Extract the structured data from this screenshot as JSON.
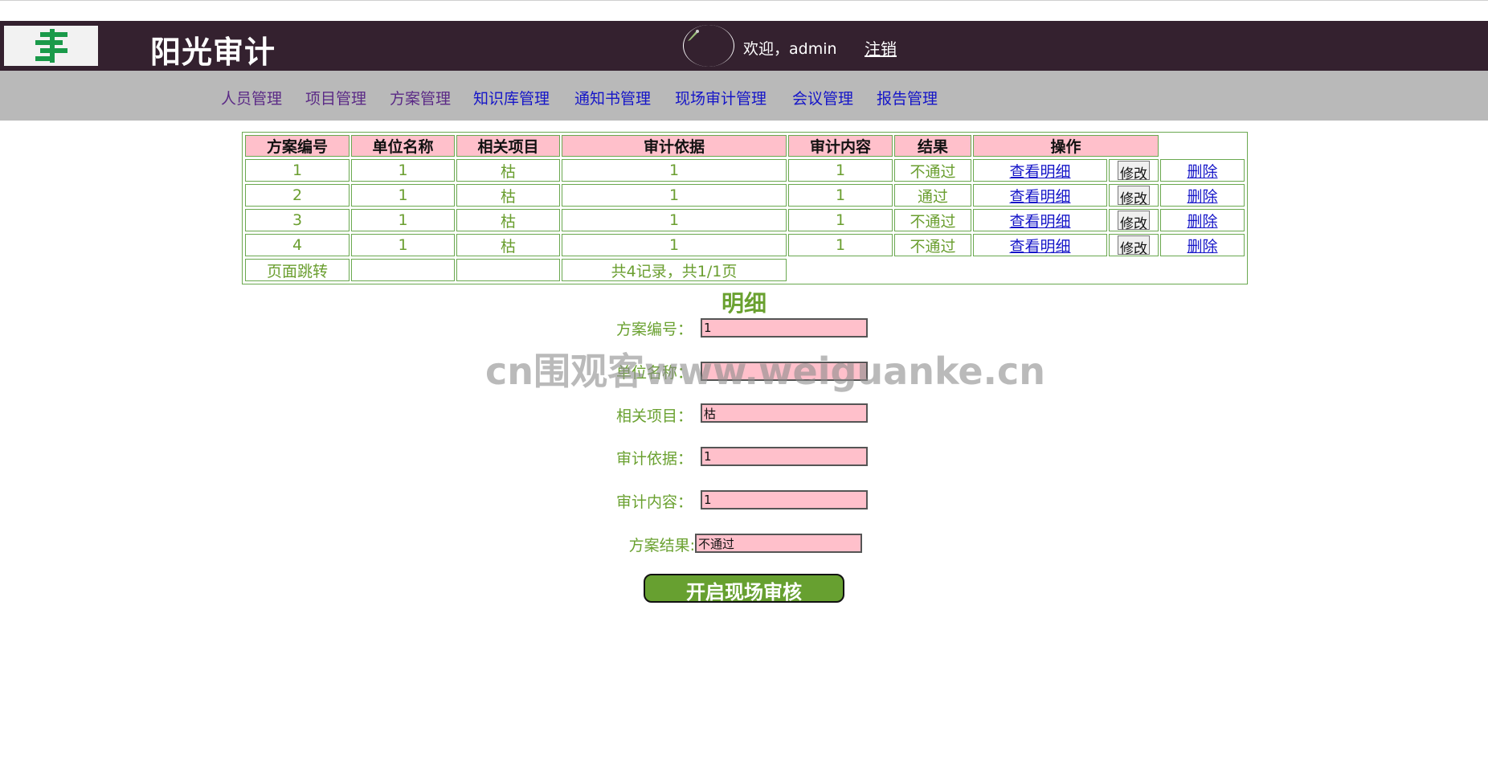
{
  "header": {
    "title": "阳光审计",
    "welcome": "欢迎，admin",
    "logout": "注销",
    "colors": {
      "header_bg": "#34212f",
      "nav_bg": "#b9b9b9"
    }
  },
  "nav": [
    {
      "label": "人员管理"
    },
    {
      "label": "项目管理"
    },
    {
      "label": "方案管理"
    },
    {
      "label": "知识库管理"
    },
    {
      "label": "通知书管理"
    },
    {
      "label": "现场审计管理"
    },
    {
      "label": "会议管理"
    },
    {
      "label": "报告管理"
    }
  ],
  "table": {
    "headers": [
      "方案编号",
      "单位名称",
      "相关项目",
      "审计依据",
      "审计内容",
      "结果",
      "操作"
    ],
    "rows": [
      {
        "id": "1",
        "unit": "1",
        "project": "枯",
        "basis": "1",
        "content": "1",
        "result": "不通过",
        "view": "查看明细",
        "edit": "修改",
        "delete": "删除"
      },
      {
        "id": "2",
        "unit": "1",
        "project": "枯",
        "basis": "1",
        "content": "1",
        "result": "通过",
        "view": "查看明细",
        "edit": "修改",
        "delete": "删除"
      },
      {
        "id": "3",
        "unit": "1",
        "project": "枯",
        "basis": "1",
        "content": "1",
        "result": "不通过",
        "view": "查看明细",
        "edit": "修改",
        "delete": "删除"
      },
      {
        "id": "4",
        "unit": "1",
        "project": "枯",
        "basis": "1",
        "content": "1",
        "result": "不通过",
        "view": "查看明细",
        "edit": "修改",
        "delete": "删除"
      }
    ],
    "footer": {
      "jump": "页面跳转",
      "summary": "共4记录，共1/1页"
    }
  },
  "detail": {
    "title": "明细",
    "fields": [
      {
        "label": "方案编号：",
        "value": "1"
      },
      {
        "label": "单位名称：",
        "value": ""
      },
      {
        "label": "相关项目：",
        "value": "枯"
      },
      {
        "label": "审计依据：",
        "value": "1"
      },
      {
        "label": "审计内容：",
        "value": "1"
      },
      {
        "label": "方案结果:",
        "value": "不通过"
      }
    ],
    "start_button": "开启现场审核"
  },
  "watermark": "cn围观客www.weiguanke.cn"
}
